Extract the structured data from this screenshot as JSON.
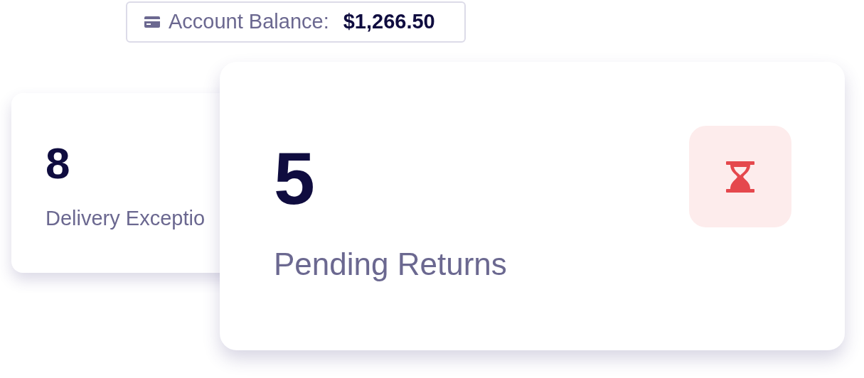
{
  "balance": {
    "label": "Account Balance:",
    "value": "$1,266.50"
  },
  "cards": [
    {
      "value": "8",
      "label": "Delivery Exceptio",
      "kind": "plain"
    },
    {
      "value": "5",
      "label": "Pending Returns",
      "kind": "with_icon"
    }
  ]
}
